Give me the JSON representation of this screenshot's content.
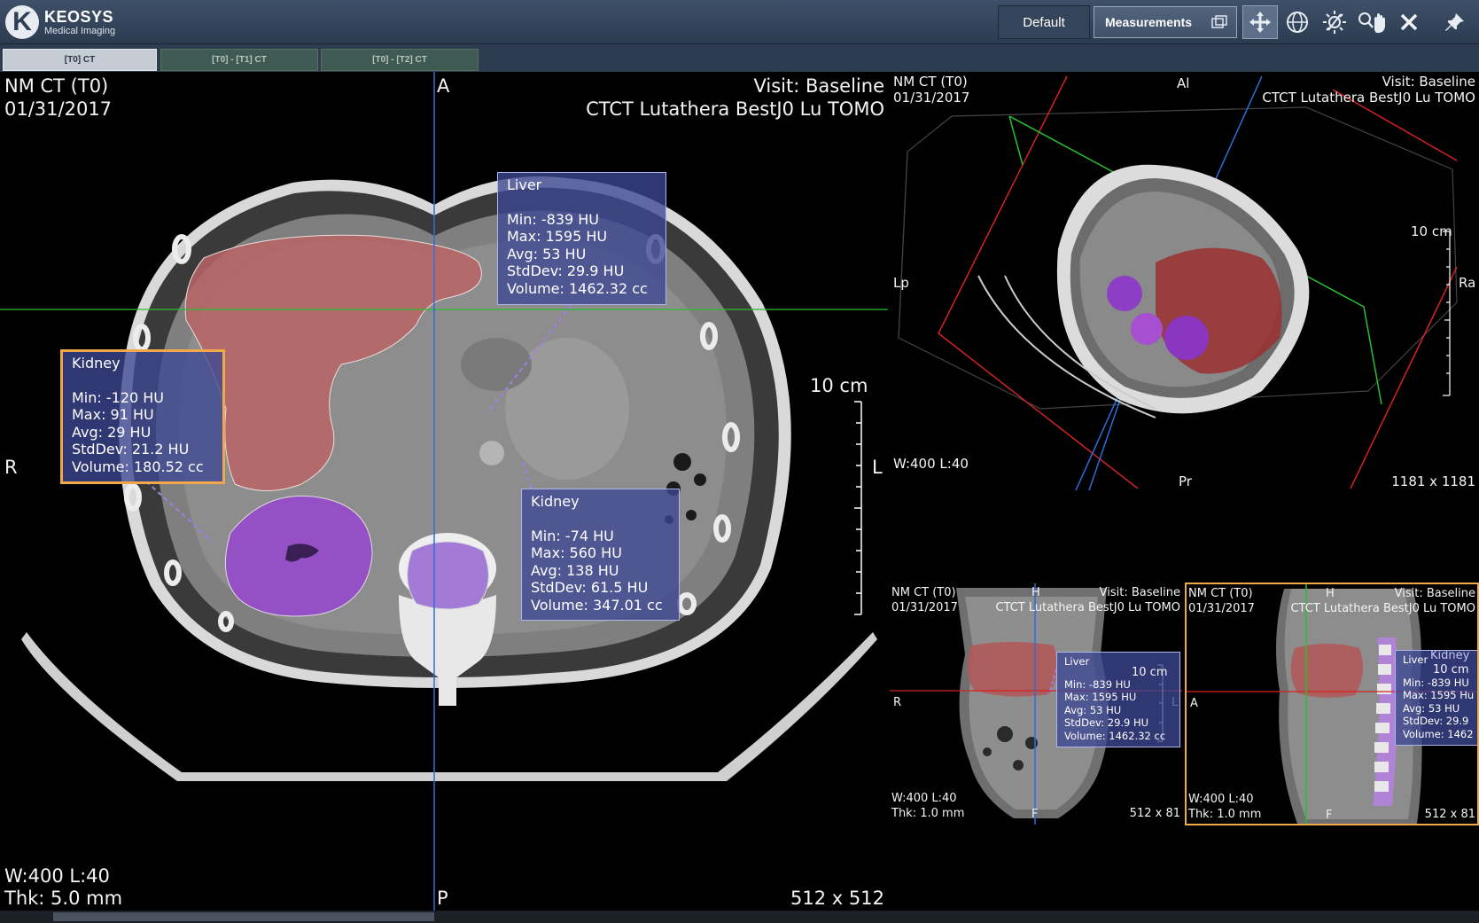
{
  "app": {
    "logo_name": "KEOSYS",
    "logo_sub": "Medical Imaging",
    "layout_button": "Default",
    "measurements_button": "Measurements"
  },
  "toolbar": {
    "tools": [
      {
        "name": "pan-arrows-icon",
        "active": true
      },
      {
        "name": "crosshair-globe-icon",
        "active": false
      },
      {
        "name": "window-level-icon",
        "active": false
      },
      {
        "name": "zoom-pan-icon",
        "active": false
      },
      {
        "name": "close-icon",
        "active": false
      },
      {
        "name": "pin-icon",
        "active": false
      }
    ]
  },
  "tabs": [
    {
      "label": "[T0] CT",
      "active": true
    },
    {
      "label": "[T0] - [T1] CT",
      "active": false
    },
    {
      "label": "[T0] - [T2] CT",
      "active": false
    }
  ],
  "axial": {
    "study": "NM CT (T0)",
    "date": "01/31/2017",
    "visit": "Visit: Baseline",
    "series": "CTCT Lutathera BestJ0 Lu TOMO",
    "orient_top": "A",
    "orient_bottom": "P",
    "orient_left": "R",
    "orient_right": "L",
    "scale": "10 cm",
    "wl": "W:400  L:40",
    "thk": "Thk: 5.0 mm",
    "matrix": "512 x 512",
    "annotations": [
      {
        "title": "Liver",
        "min": "Min: -839 HU",
        "max": "Max: 1595 HU",
        "avg": "Avg: 53 HU",
        "std": "StdDev: 29.9 HU",
        "vol": "Volume: 1462.32 cc"
      },
      {
        "title": "Kidney",
        "min": "Min: -120 HU",
        "max": "Max: 91 HU",
        "avg": "Avg: 29 HU",
        "std": "StdDev: 21.2 HU",
        "vol": "Volume: 180.52 cc"
      },
      {
        "title": "Kidney",
        "min": "Min: -74 HU",
        "max": "Max: 560 HU",
        "avg": "Avg: 138 HU",
        "std": "StdDev: 61.5 HU",
        "vol": "Volume: 347.01 cc"
      }
    ]
  },
  "threed": {
    "study": "NM CT (T0)",
    "date": "01/31/2017",
    "visit": "Visit: Baseline",
    "series": "CTCT Lutathera BestJ0 Lu TOMO",
    "orient_top": "Al",
    "orient_bottom": "Pr",
    "orient_left": "Lp",
    "orient_right": "Ra",
    "scale": "10 cm",
    "wl": "W:400  L:40",
    "matrix": "1181 x 1181"
  },
  "coronal": {
    "study": "NM CT (T0)",
    "date": "01/31/2017",
    "visit": "Visit: Baseline",
    "series": "CTCT Lutathera BestJ0 Lu TOMO",
    "orient_top": "H",
    "orient_bottom": "F",
    "orient_left": "R",
    "orient_right": "L",
    "scale": "10 cm",
    "wl": "W:400  L:40",
    "thk": "Thk: 1.0 mm",
    "matrix": "512 x 81",
    "annotation": {
      "title": "Liver",
      "min": "Min: -839 HU",
      "max": "Max: 1595 HU",
      "avg": "Avg: 53 HU",
      "std": "StdDev: 29.9 HU",
      "vol": "Volume: 1462.32 cc"
    }
  },
  "sagittal": {
    "study": "NM CT (T0)",
    "date": "01/31/2017",
    "visit": "Visit: Baseline",
    "series": "CTCT Lutathera BestJ0 Lu TOMO",
    "orient_top": "H",
    "orient_bottom": "F",
    "orient_left": "A",
    "scale": "10 cm",
    "wl": "W:400  L:40",
    "thk": "Thk: 1.0 mm",
    "matrix": "512 x 81",
    "annotation": {
      "title": "Liver",
      "min": "Min: -839 HU",
      "max": "Max: 1595 Hu",
      "avg": "Avg: 53 HU",
      "std": "StdDev: 29.9",
      "vol": "Volume: 1462"
    },
    "annotation2_title": "Kidney"
  }
}
